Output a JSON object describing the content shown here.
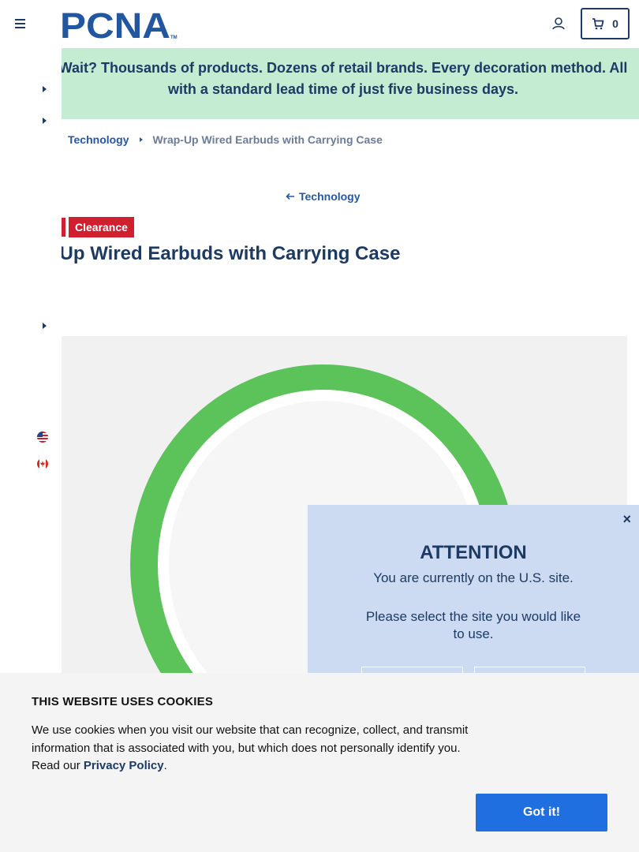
{
  "header": {
    "logo_text": "PCNA",
    "logo_tm": "TM",
    "cart_count": "0"
  },
  "promo": {
    "line1": "Wait? Thousands of products. Dozens of retail brands. Every decoration method. All",
    "line2": "with a standard lead time of just five business days."
  },
  "breadcrumb": {
    "category": "Technology",
    "current": "Wrap-Up Wired Earbuds with Carrying Case"
  },
  "back_link": "Technology",
  "badge": "Clearance",
  "product": {
    "title": "Wrap-Up Wired Earbuds with Carrying Case"
  },
  "modal": {
    "close": "×",
    "title": "ATTENTION",
    "line1": "You are currently on the U.S. site.",
    "line2": "Please select the site you would like to use."
  },
  "cookie": {
    "title": "THIS WEBSITE USES COOKIES",
    "body": "We use cookies when you visit our website that can recognize, collect, and transmit information that is associated with you, but which does not personally identify you. Read our ",
    "link": "Privacy Policy",
    "end": ".",
    "button": "Got it!"
  },
  "colors": {
    "brand_navy": "#1c3a64",
    "promo_green": "#c3ecd3",
    "clearance_red": "#d0202f",
    "modal_blue": "#cddbf2",
    "button_blue": "#1f6fe0",
    "case_green": "#5cc25a"
  },
  "icons": [
    "menu-icon",
    "user-icon",
    "cart-icon",
    "caret-right-icon",
    "arrow-left-icon",
    "us-flag-icon",
    "canada-flag-icon",
    "close-icon"
  ]
}
